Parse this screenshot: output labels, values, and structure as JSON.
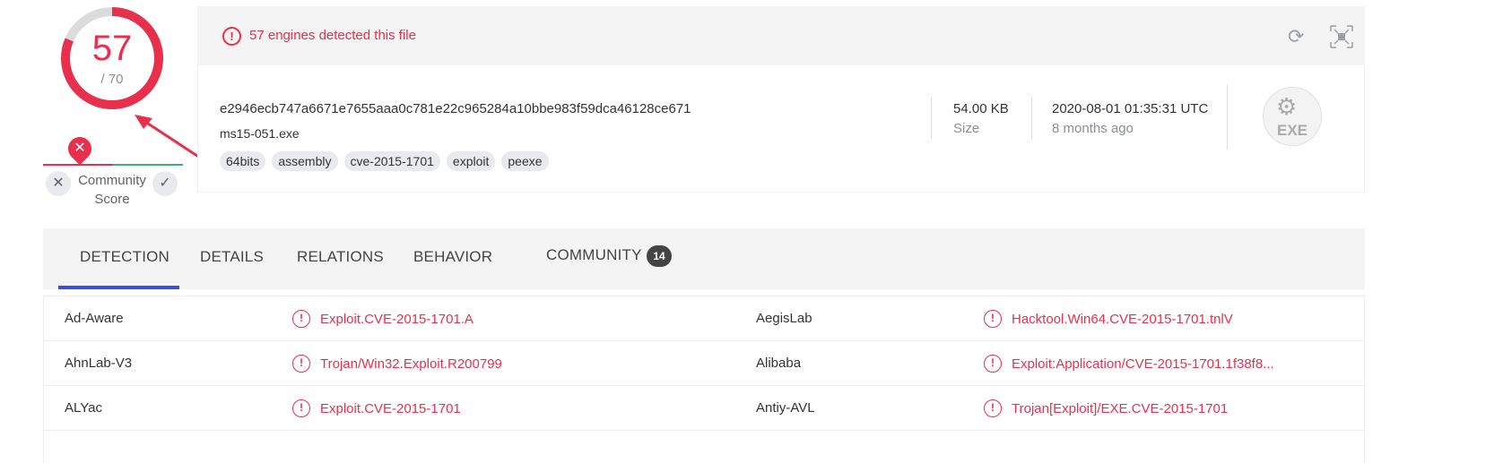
{
  "score": {
    "detected": "57",
    "total": "/ 70",
    "community_label": "Community Score",
    "fraction": 0.814
  },
  "banner": {
    "text": "57 engines detected this file"
  },
  "file": {
    "hash": "e2946ecb747a6671e7655aaa0c781e22c965284a10bbe983f59dca46128ce671",
    "name": "ms15-051.exe",
    "tags": [
      "64bits",
      "assembly",
      "cve-2015-1701",
      "exploit",
      "peexe"
    ],
    "size_value": "54.00 KB",
    "size_label": "Size",
    "date_value": "2020-08-01 01:35:31 UTC",
    "date_label": "8 months ago",
    "type_icon_text": "EXE"
  },
  "tabs": {
    "detection": "DETECTION",
    "details": "DETAILS",
    "relations": "RELATIONS",
    "behavior": "BEHAVIOR",
    "community": "COMMUNITY",
    "community_count": "14"
  },
  "results": [
    {
      "engine_left": "Ad-Aware",
      "result_left": "Exploit.CVE-2015-1701.A",
      "engine_right": "AegisLab",
      "result_right": "Hacktool.Win64.CVE-2015-1701.tnlV"
    },
    {
      "engine_left": "AhnLab-V3",
      "result_left": "Trojan/Win32.Exploit.R200799",
      "engine_right": "Alibaba",
      "result_right": "Exploit:Application/CVE-2015-1701.1f38f8..."
    },
    {
      "engine_left": "ALYac",
      "result_left": "Exploit.CVE-2015-1701",
      "engine_right": "Antiy-AVL",
      "result_right": "Trojan[Exploit]/EXE.CVE-2015-1701"
    }
  ],
  "colors": {
    "danger": "#e8304c",
    "tab_active": "#3b4ce0",
    "harmless": "#3cb371"
  }
}
